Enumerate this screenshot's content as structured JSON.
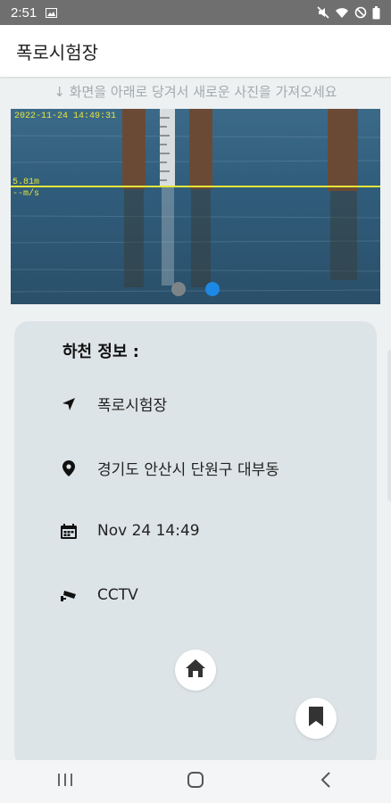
{
  "status_bar": {
    "time": "2:51",
    "icons": [
      "image-icon",
      "mute-icon",
      "wifi-icon",
      "do-not-disturb-icon",
      "battery-icon"
    ]
  },
  "app_bar": {
    "title": "폭로시험장"
  },
  "pull_hint": "↓ 화면을 아래로 당겨서 새로운 사진을 가져오세요",
  "photo": {
    "timestamp": "2022-11-24 14:49:31",
    "level": "5.81m",
    "speed": "--m/s",
    "carousel": {
      "count": 2,
      "active_index": 1
    }
  },
  "info": {
    "title": "하천 정보 :",
    "rows": [
      {
        "icon": "navigation-arrow-icon",
        "value": "폭로시험장"
      },
      {
        "icon": "location-pin-icon",
        "value": "경기도 안산시 단원구 대부동"
      },
      {
        "icon": "calendar-icon",
        "value": "Nov 24 14:49"
      },
      {
        "icon": "cctv-camera-icon",
        "value": "CCTV"
      }
    ]
  },
  "buttons": {
    "home": "home-icon",
    "bookmark": "bookmark-icon"
  },
  "nav_bar": [
    "recent-apps-icon",
    "home-circle-icon",
    "back-chevron-icon"
  ],
  "colors": {
    "status_bar": "#6f6f6f",
    "card": "#dde4e7",
    "dot_active": "#1e88e5",
    "dot_inactive": "#7d8488",
    "overlay_line": "#e6e63a"
  }
}
